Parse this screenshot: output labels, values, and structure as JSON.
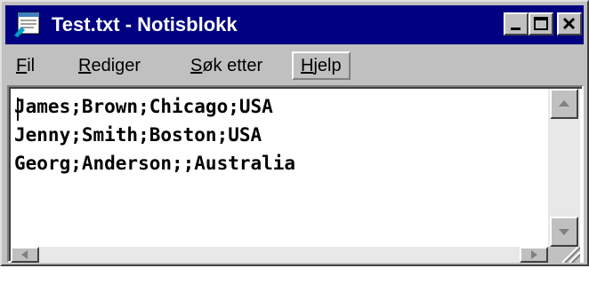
{
  "window": {
    "title": "Test.txt - Notisblokk",
    "app_icon": "notepad-icon",
    "controls": {
      "minimize": "minimize-icon",
      "maximize": "maximize-icon",
      "close": "close-icon"
    }
  },
  "menubar": {
    "items": [
      {
        "label": "Fil",
        "underline": "F",
        "rest": "il"
      },
      {
        "label": "Rediger",
        "underline": "R",
        "rest": "ediger"
      },
      {
        "label": "Søk etter",
        "underline": "S",
        "rest": "øk etter"
      },
      {
        "label": "Hjelp",
        "underline": "H",
        "rest": "jelp"
      }
    ]
  },
  "editor": {
    "lines": [
      "James;Brown;Chicago;USA",
      "Jenny;Smith;Boston;USA",
      "Georg;Anderson;;Australia"
    ]
  },
  "scrollbars": {
    "up_arrow": "arrow-up-icon",
    "down_arrow": "arrow-down-icon",
    "left_arrow": "arrow-left-icon",
    "right_arrow": "arrow-right-icon",
    "grip": "resize-grip-icon"
  },
  "colors": {
    "title_bg": "#000080",
    "face": "#c0c0c0",
    "text_bg": "#ffffff"
  }
}
